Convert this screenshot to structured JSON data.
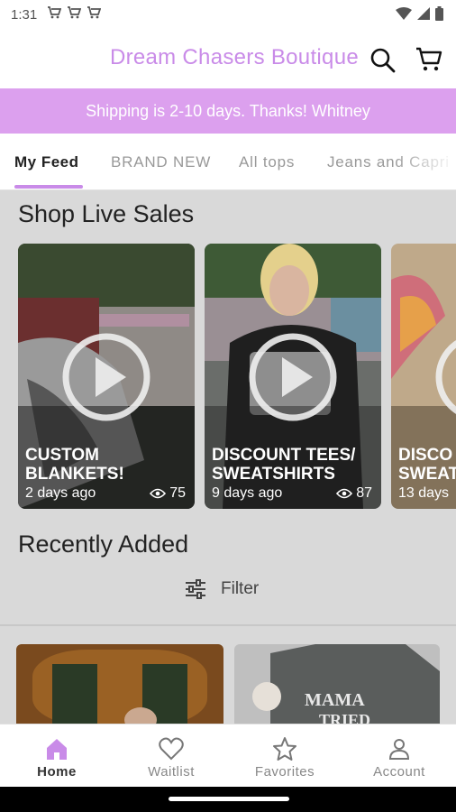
{
  "status_bar": {
    "time": "1:31"
  },
  "header": {
    "brand": "Dream Chasers Boutique"
  },
  "banner": {
    "text": "Shipping is 2-10 days. Thanks! Whitney"
  },
  "tabs": [
    {
      "label": "My Feed",
      "active": true
    },
    {
      "label": "BRAND NEW"
    },
    {
      "label": "All tops"
    },
    {
      "label": "Jeans and Capri"
    }
  ],
  "live_sales": {
    "title": "Shop Live Sales",
    "cards": [
      {
        "title_line1": "CUSTOM",
        "title_line2": "BLANKETS!",
        "ago": "2 days ago",
        "views": "75"
      },
      {
        "title_line1": "DISCOUNT TEES/",
        "title_line2": "SWEATSHIRTS",
        "ago": "9 days ago",
        "views": "87"
      },
      {
        "title_line1": "DISCO",
        "title_line2": "SWEAT",
        "ago": "13 days"
      }
    ]
  },
  "recently_added": {
    "title": "Recently Added",
    "filter_label": "Filter"
  },
  "bottom_nav": [
    {
      "label": "Home",
      "icon": "home-icon",
      "active": true
    },
    {
      "label": "Waitlist",
      "icon": "heart-icon"
    },
    {
      "label": "Favorites",
      "icon": "star-icon"
    },
    {
      "label": "Account",
      "icon": "person-icon"
    }
  ],
  "colors": {
    "brand": "#c98be8",
    "banner": "#dca0ee",
    "overlay_bg": "#d9d9d9"
  }
}
